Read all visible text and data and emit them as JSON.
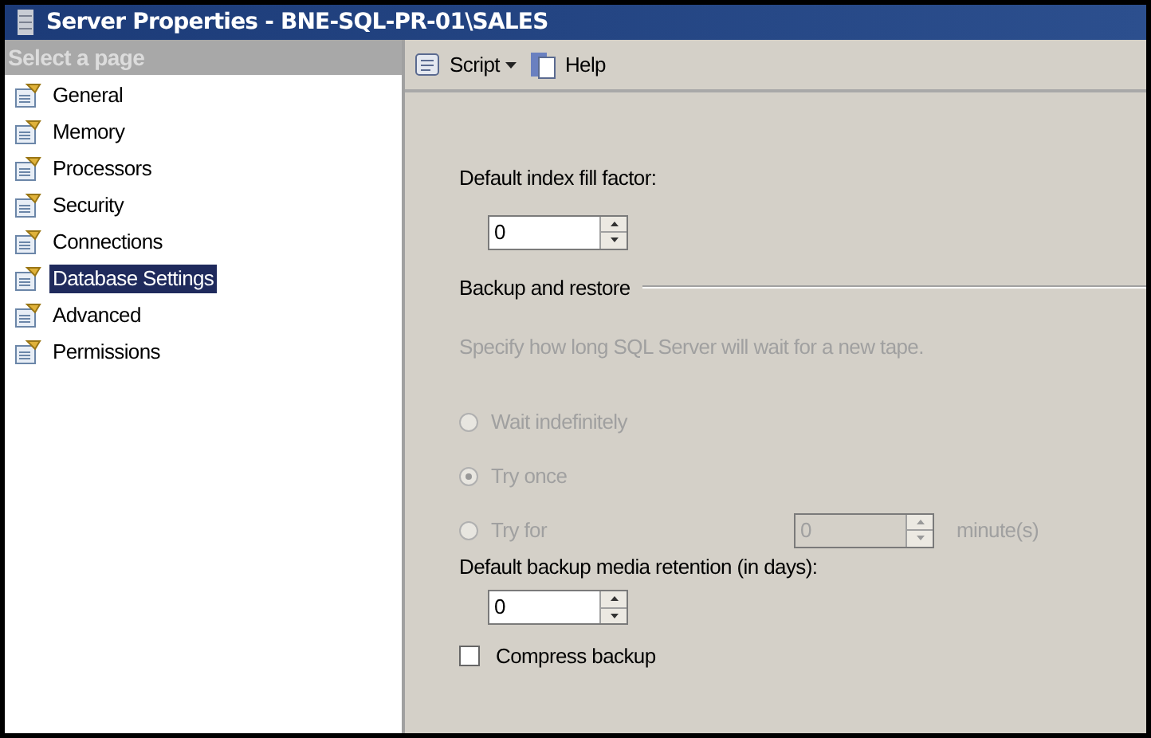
{
  "window": {
    "title": "Server Properties - BNE-SQL-PR-01\\SALES"
  },
  "sidebar": {
    "header": "Select a page",
    "items": [
      {
        "label": "General",
        "selected": false
      },
      {
        "label": "Memory",
        "selected": false
      },
      {
        "label": "Processors",
        "selected": false
      },
      {
        "label": "Security",
        "selected": false
      },
      {
        "label": "Connections",
        "selected": false
      },
      {
        "label": "Database Settings",
        "selected": true
      },
      {
        "label": "Advanced",
        "selected": false
      },
      {
        "label": "Permissions",
        "selected": false
      }
    ]
  },
  "toolbar": {
    "script": "Script",
    "help": "Help"
  },
  "fill_factor": {
    "label": "Default index fill factor:",
    "value": "0"
  },
  "backup": {
    "heading": "Backup and restore",
    "hint": "Specify how long SQL Server will wait for a new tape.",
    "disabled": true,
    "options": [
      {
        "label": "Wait indefinitely",
        "selected": false
      },
      {
        "label": "Try once",
        "selected": true
      },
      {
        "label": "Try for",
        "selected": false,
        "value": "0",
        "unit": "minute(s)"
      }
    ]
  },
  "retention": {
    "label": "Default backup media retention (in days):",
    "value": "0"
  },
  "compress": {
    "label": "Compress backup",
    "checked": false
  }
}
